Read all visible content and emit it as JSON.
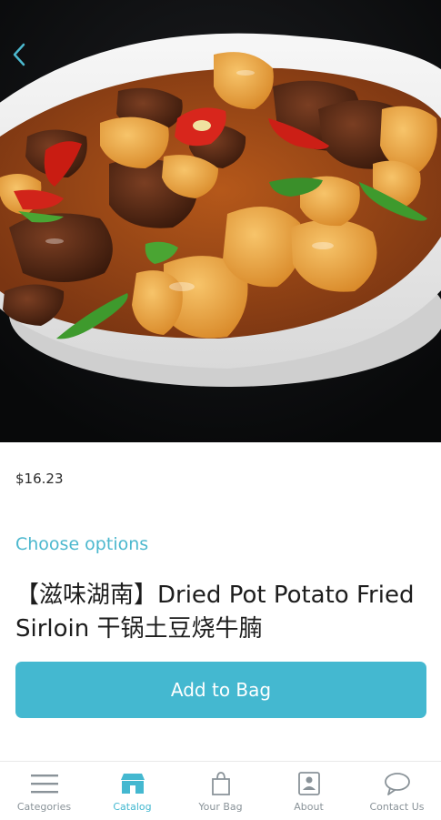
{
  "product": {
    "price": "$16.23",
    "choose_options_label": "Choose options",
    "title": "【滋味湖南】Dried Pot Potato Fried Sirloin 干锅土豆烧牛腩",
    "add_to_bag_label": "Add to Bag"
  },
  "nav": {
    "back_icon": "chevron-left-icon"
  },
  "tabbar": {
    "active": "Catalog",
    "items": [
      {
        "label": "Categories",
        "icon": "menu-lines-icon"
      },
      {
        "label": "Catalog",
        "icon": "store-icon"
      },
      {
        "label": "Your Bag",
        "icon": "shopping-bag-icon"
      },
      {
        "label": "About",
        "icon": "profile-card-icon"
      },
      {
        "label": "Contact Us",
        "icon": "chat-bubble-icon"
      }
    ]
  },
  "colors": {
    "accent": "#44b8d0",
    "link": "#4cb8ce",
    "tab_inactive": "#8a9399",
    "hero_background": "#0e0f11"
  }
}
